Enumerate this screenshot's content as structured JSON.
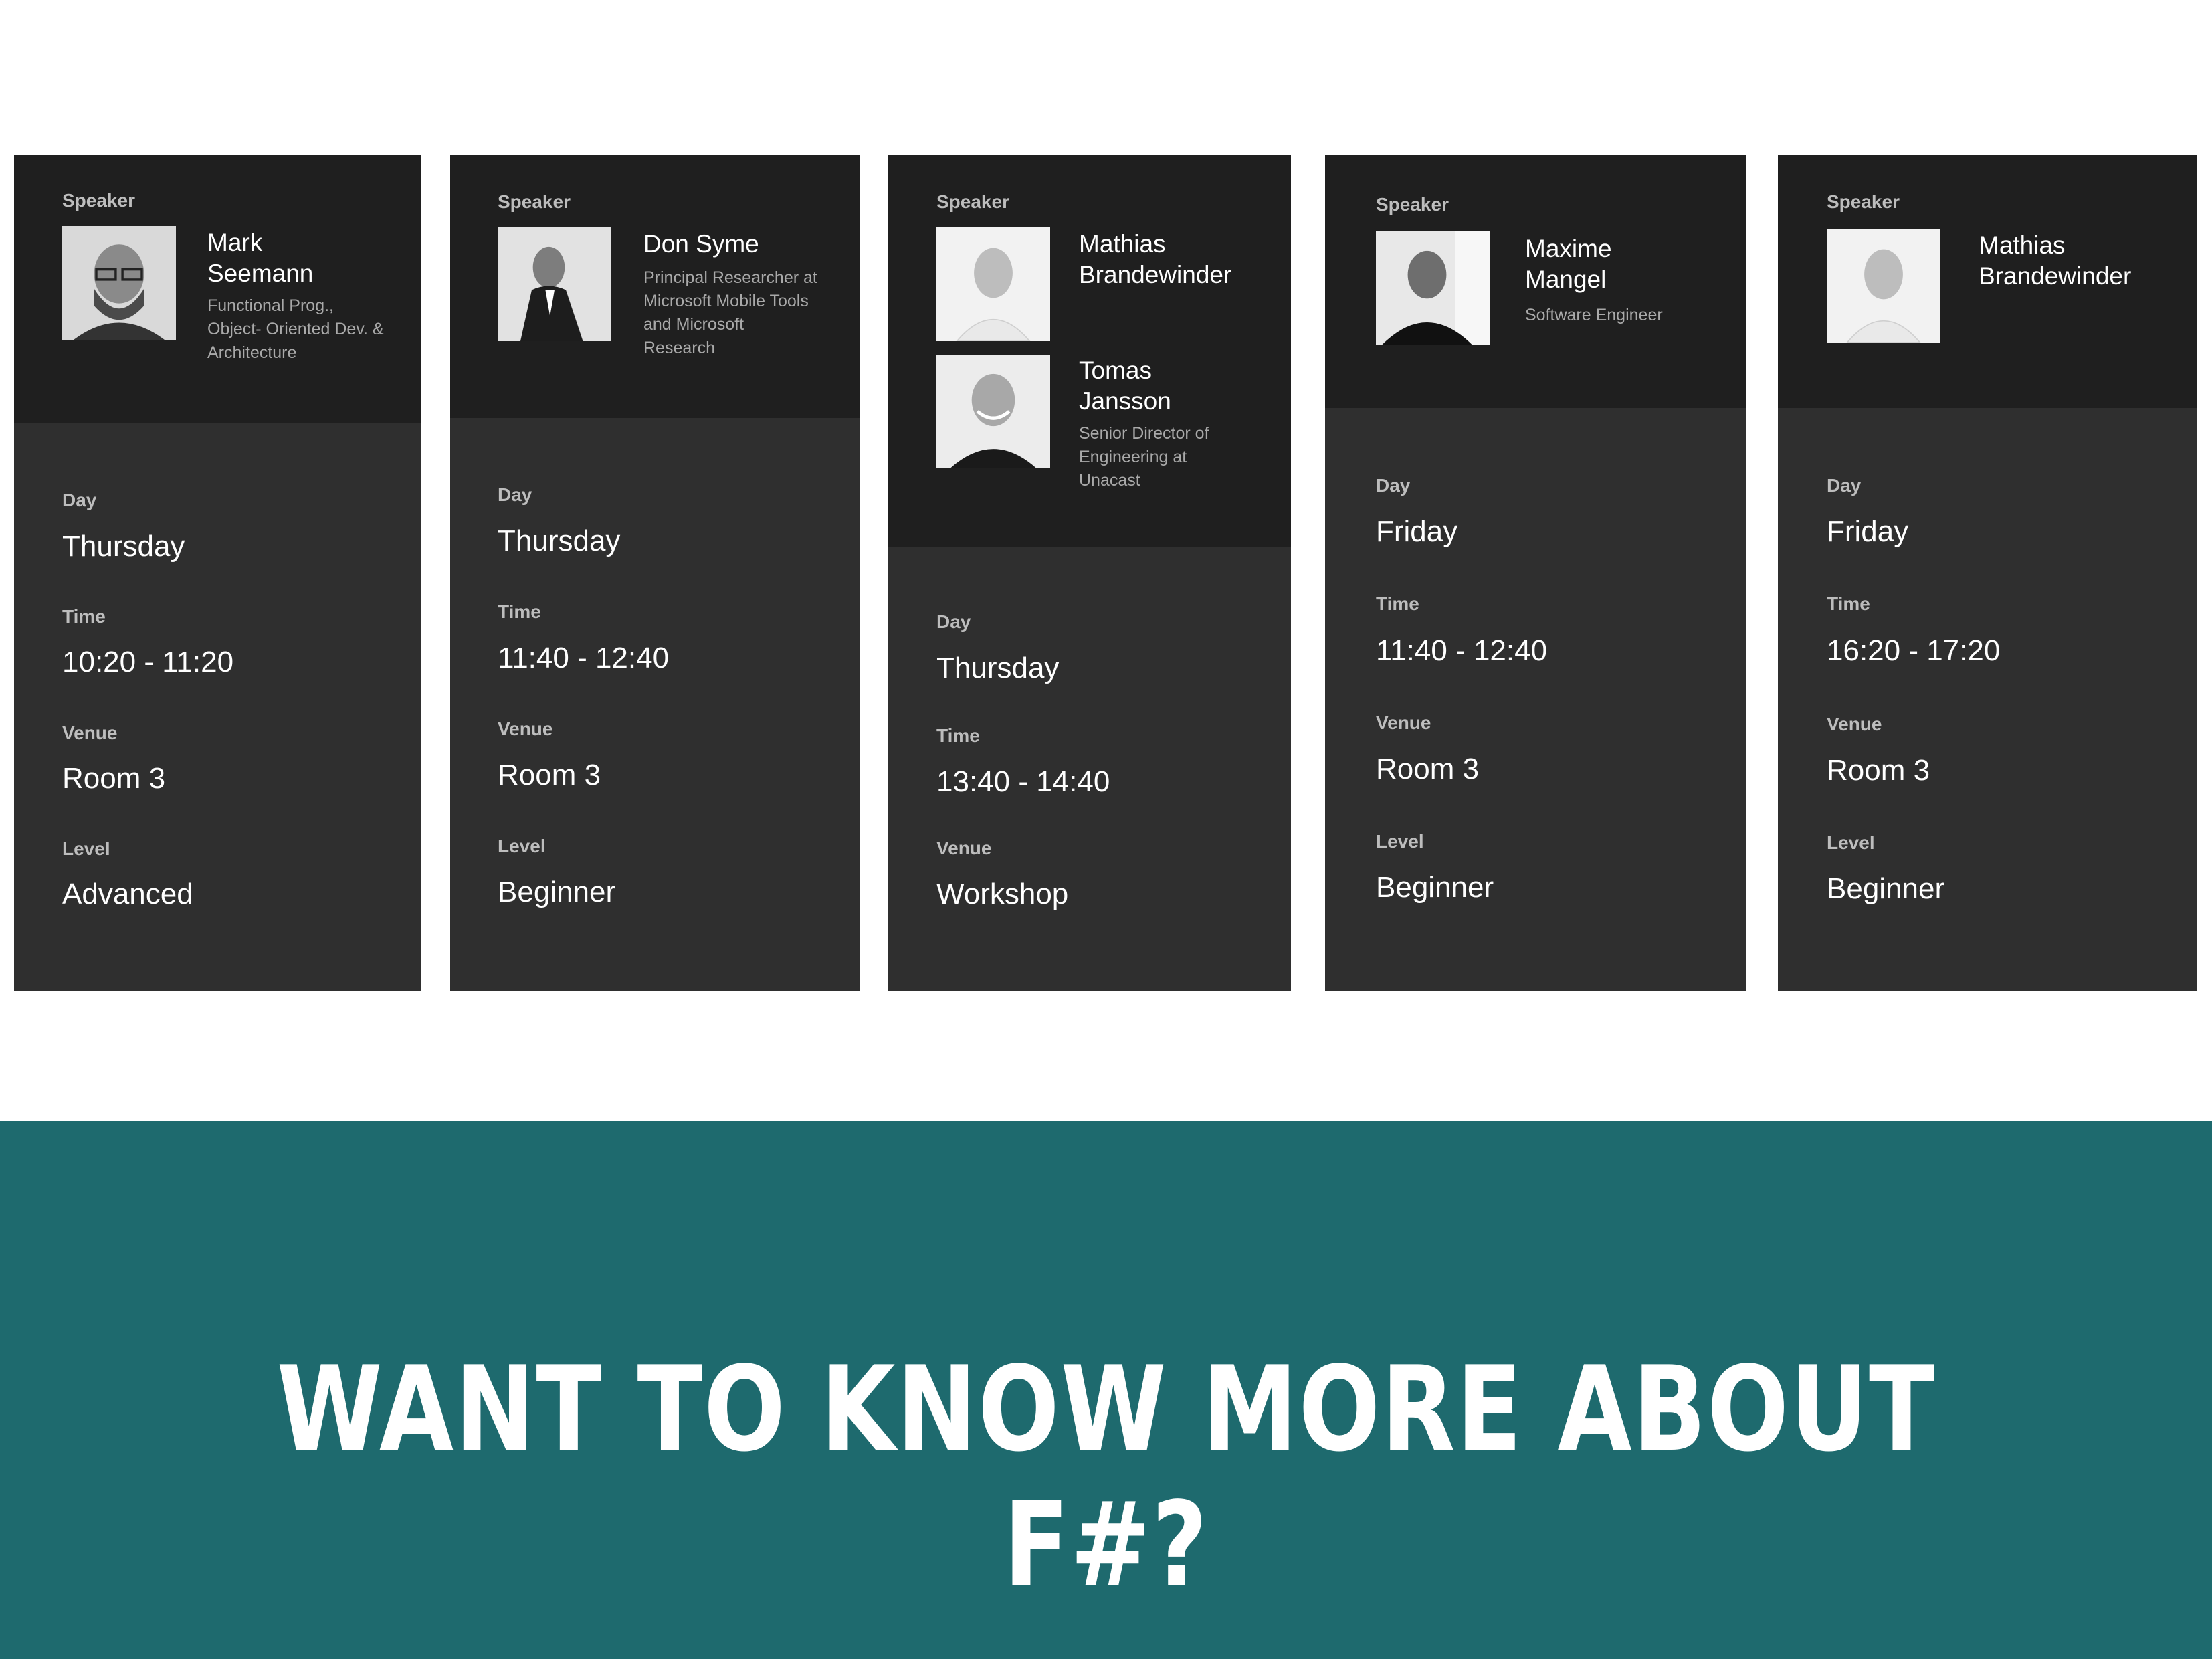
{
  "labels": {
    "speaker": "Speaker",
    "day": "Day",
    "time": "Time",
    "venue": "Venue",
    "level": "Level"
  },
  "cards": [
    {
      "speakers": [
        {
          "name": "Mark Seemann",
          "title": "Functional Prog., Object- Oriented Dev. & Architecture"
        }
      ],
      "day": "Thursday",
      "time": "10:20 - 11:20",
      "venue": "Room 3",
      "level": "Advanced"
    },
    {
      "speakers": [
        {
          "name": "Don Syme",
          "title": "Principal Researcher at Microsoft Mobile Tools and Microsoft Research"
        }
      ],
      "day": "Thursday",
      "time": "11:40 - 12:40",
      "venue": "Room 3",
      "level": "Beginner"
    },
    {
      "speakers": [
        {
          "name": "Mathias Brandewinder",
          "title": ""
        },
        {
          "name": "Tomas Jansson",
          "title": "Senior Director of Engineering at Unacast"
        }
      ],
      "day": "Thursday",
      "time": "13:40 - 14:40",
      "venue": "Workshop"
    },
    {
      "speakers": [
        {
          "name": "Maxime Mangel",
          "title": "Software Engineer"
        }
      ],
      "day": "Friday",
      "time": "11:40 - 12:40",
      "venue": "Room 3",
      "level": "Beginner"
    },
    {
      "speakers": [
        {
          "name": "Mathias Brandewinder",
          "title": ""
        }
      ],
      "day": "Friday",
      "time": "16:20 - 17:20",
      "venue": "Room 3",
      "level": "Beginner"
    }
  ],
  "banner": {
    "text": "WANT TO KNOW MORE ABOUT F#?",
    "color": "#1e6a6e"
  }
}
